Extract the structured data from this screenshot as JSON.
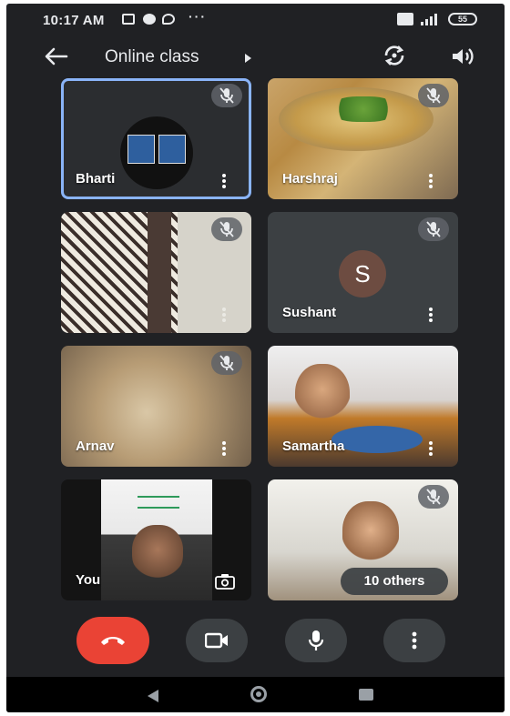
{
  "status_bar": {
    "time": "10:17 AM",
    "more": "···",
    "battery": "55"
  },
  "header": {
    "title": "Online class",
    "back_icon": "arrow-left-icon",
    "switch_camera_icon": "switch-camera-icon",
    "speaker_icon": "speaker-icon"
  },
  "participants": [
    {
      "name": "Bharti",
      "muted": true,
      "active_speaker": true
    },
    {
      "name": "Harshraj",
      "muted": true
    },
    {
      "name": "",
      "muted": true
    },
    {
      "name": "Sushant",
      "muted": true,
      "initial": "S",
      "avatar_color": "#6d4c41"
    },
    {
      "name": "Arnav",
      "muted": true
    },
    {
      "name": "Samartha",
      "muted": false
    },
    {
      "name": "You",
      "muted": false,
      "self": true
    },
    {
      "name": "",
      "muted": true,
      "overflow": "10 others"
    }
  ],
  "controls": {
    "end_call_color": "#ea4335",
    "buttons": [
      "end-call-icon",
      "camera-icon",
      "microphone-icon",
      "more-vert-icon"
    ]
  },
  "colors": {
    "background": "#202124",
    "tile": "#3c4043",
    "active_border": "#8ab4f8"
  }
}
